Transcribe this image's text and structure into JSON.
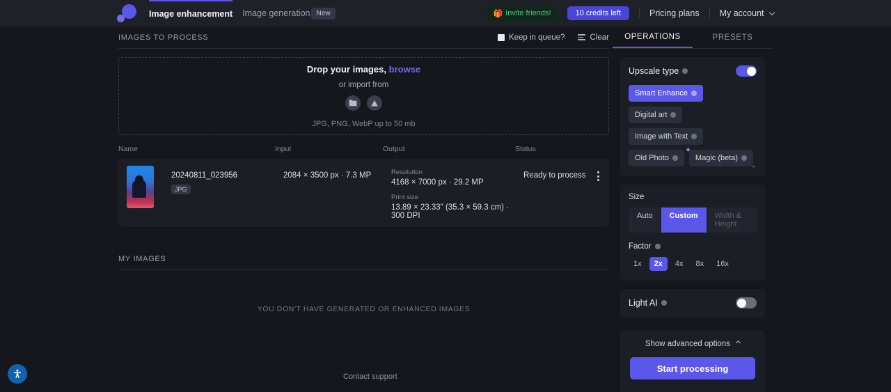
{
  "header": {
    "logo_icon": "logo-circles-icon",
    "tabs": [
      {
        "label": "Image enhancement",
        "active": true
      },
      {
        "label": "Image generation",
        "active": false,
        "badge": "New"
      }
    ],
    "invite": {
      "label": "Invite friends!",
      "icon": "gift-icon"
    },
    "credits": "10 credits left",
    "pricing": "Pricing plans",
    "account": "My account"
  },
  "images_to_process": {
    "title": "IMAGES TO PROCESS",
    "keep_in_queue_label": "Keep in queue?",
    "keep_in_queue_checked": true,
    "clear_label": "Clear",
    "clear_icon": "filter-lines-icon"
  },
  "dropzone": {
    "main_prefix": "Drop your images,",
    "browse": "browse",
    "or_import": "or import from",
    "icons": [
      "folder-icon",
      "google-drive-icon"
    ],
    "note": "JPG, PNG, WebP up to 50 mb"
  },
  "table": {
    "columns": [
      "Name",
      "Input",
      "Output",
      "Status"
    ],
    "rows": [
      {
        "name": "20240811_023956",
        "filetype": "JPG",
        "input": "2084 × 3500 px · 7.3 MP",
        "output_resolution_label": "Resolution",
        "output_resolution": "4168 × 7000 px · 29.2 MP",
        "output_print_label": "Print size",
        "output_print": "13.89 × 23.33\" (35.3 × 59.3 cm) · 300 DPI",
        "status": "Ready to process",
        "menu_icon": "kebab-menu-icon"
      }
    ]
  },
  "my_images": {
    "title": "MY IMAGES",
    "empty": "YOU DON'T HAVE GENERATED OR ENHANCED IMAGES"
  },
  "right_panel": {
    "tabs": [
      {
        "label": "OPERATIONS",
        "active": true
      },
      {
        "label": "PRESETS",
        "active": false
      }
    ],
    "upscale": {
      "title": "Upscale type",
      "enabled": true,
      "options": [
        {
          "label": "Smart Enhance",
          "selected": true
        },
        {
          "label": "Digital art",
          "selected": false
        },
        {
          "label": "Image with Text",
          "selected": false
        },
        {
          "label": "Old Photo",
          "selected": false
        },
        {
          "label": "Magic (beta)",
          "selected": false,
          "icon": "sparkle-icon"
        }
      ]
    },
    "size": {
      "title": "Size",
      "modes": [
        {
          "label": "Auto",
          "selected": false,
          "disabled": false
        },
        {
          "label": "Custom",
          "selected": true,
          "disabled": false
        },
        {
          "label": "Width & Height",
          "selected": false,
          "disabled": true
        }
      ],
      "factor_label": "Factor",
      "factors": [
        {
          "label": "1x",
          "selected": false
        },
        {
          "label": "2x",
          "selected": true
        },
        {
          "label": "4x",
          "selected": false
        },
        {
          "label": "8x",
          "selected": false
        },
        {
          "label": "16x",
          "selected": false
        }
      ]
    },
    "light_ai": {
      "title": "Light AI",
      "enabled": false
    },
    "advanced_label": "Show advanced options",
    "start_label": "Start processing"
  },
  "footer": {
    "contact": "Contact support",
    "a11y_icon": "accessibility-icon"
  },
  "colors": {
    "accent": "#5b57e8",
    "page_bg": "#15171c",
    "header_bg": "#1f2128",
    "card_bg": "#1b1e25",
    "invite_green": "#4ec07c",
    "a11y_blue": "#1063b0"
  }
}
